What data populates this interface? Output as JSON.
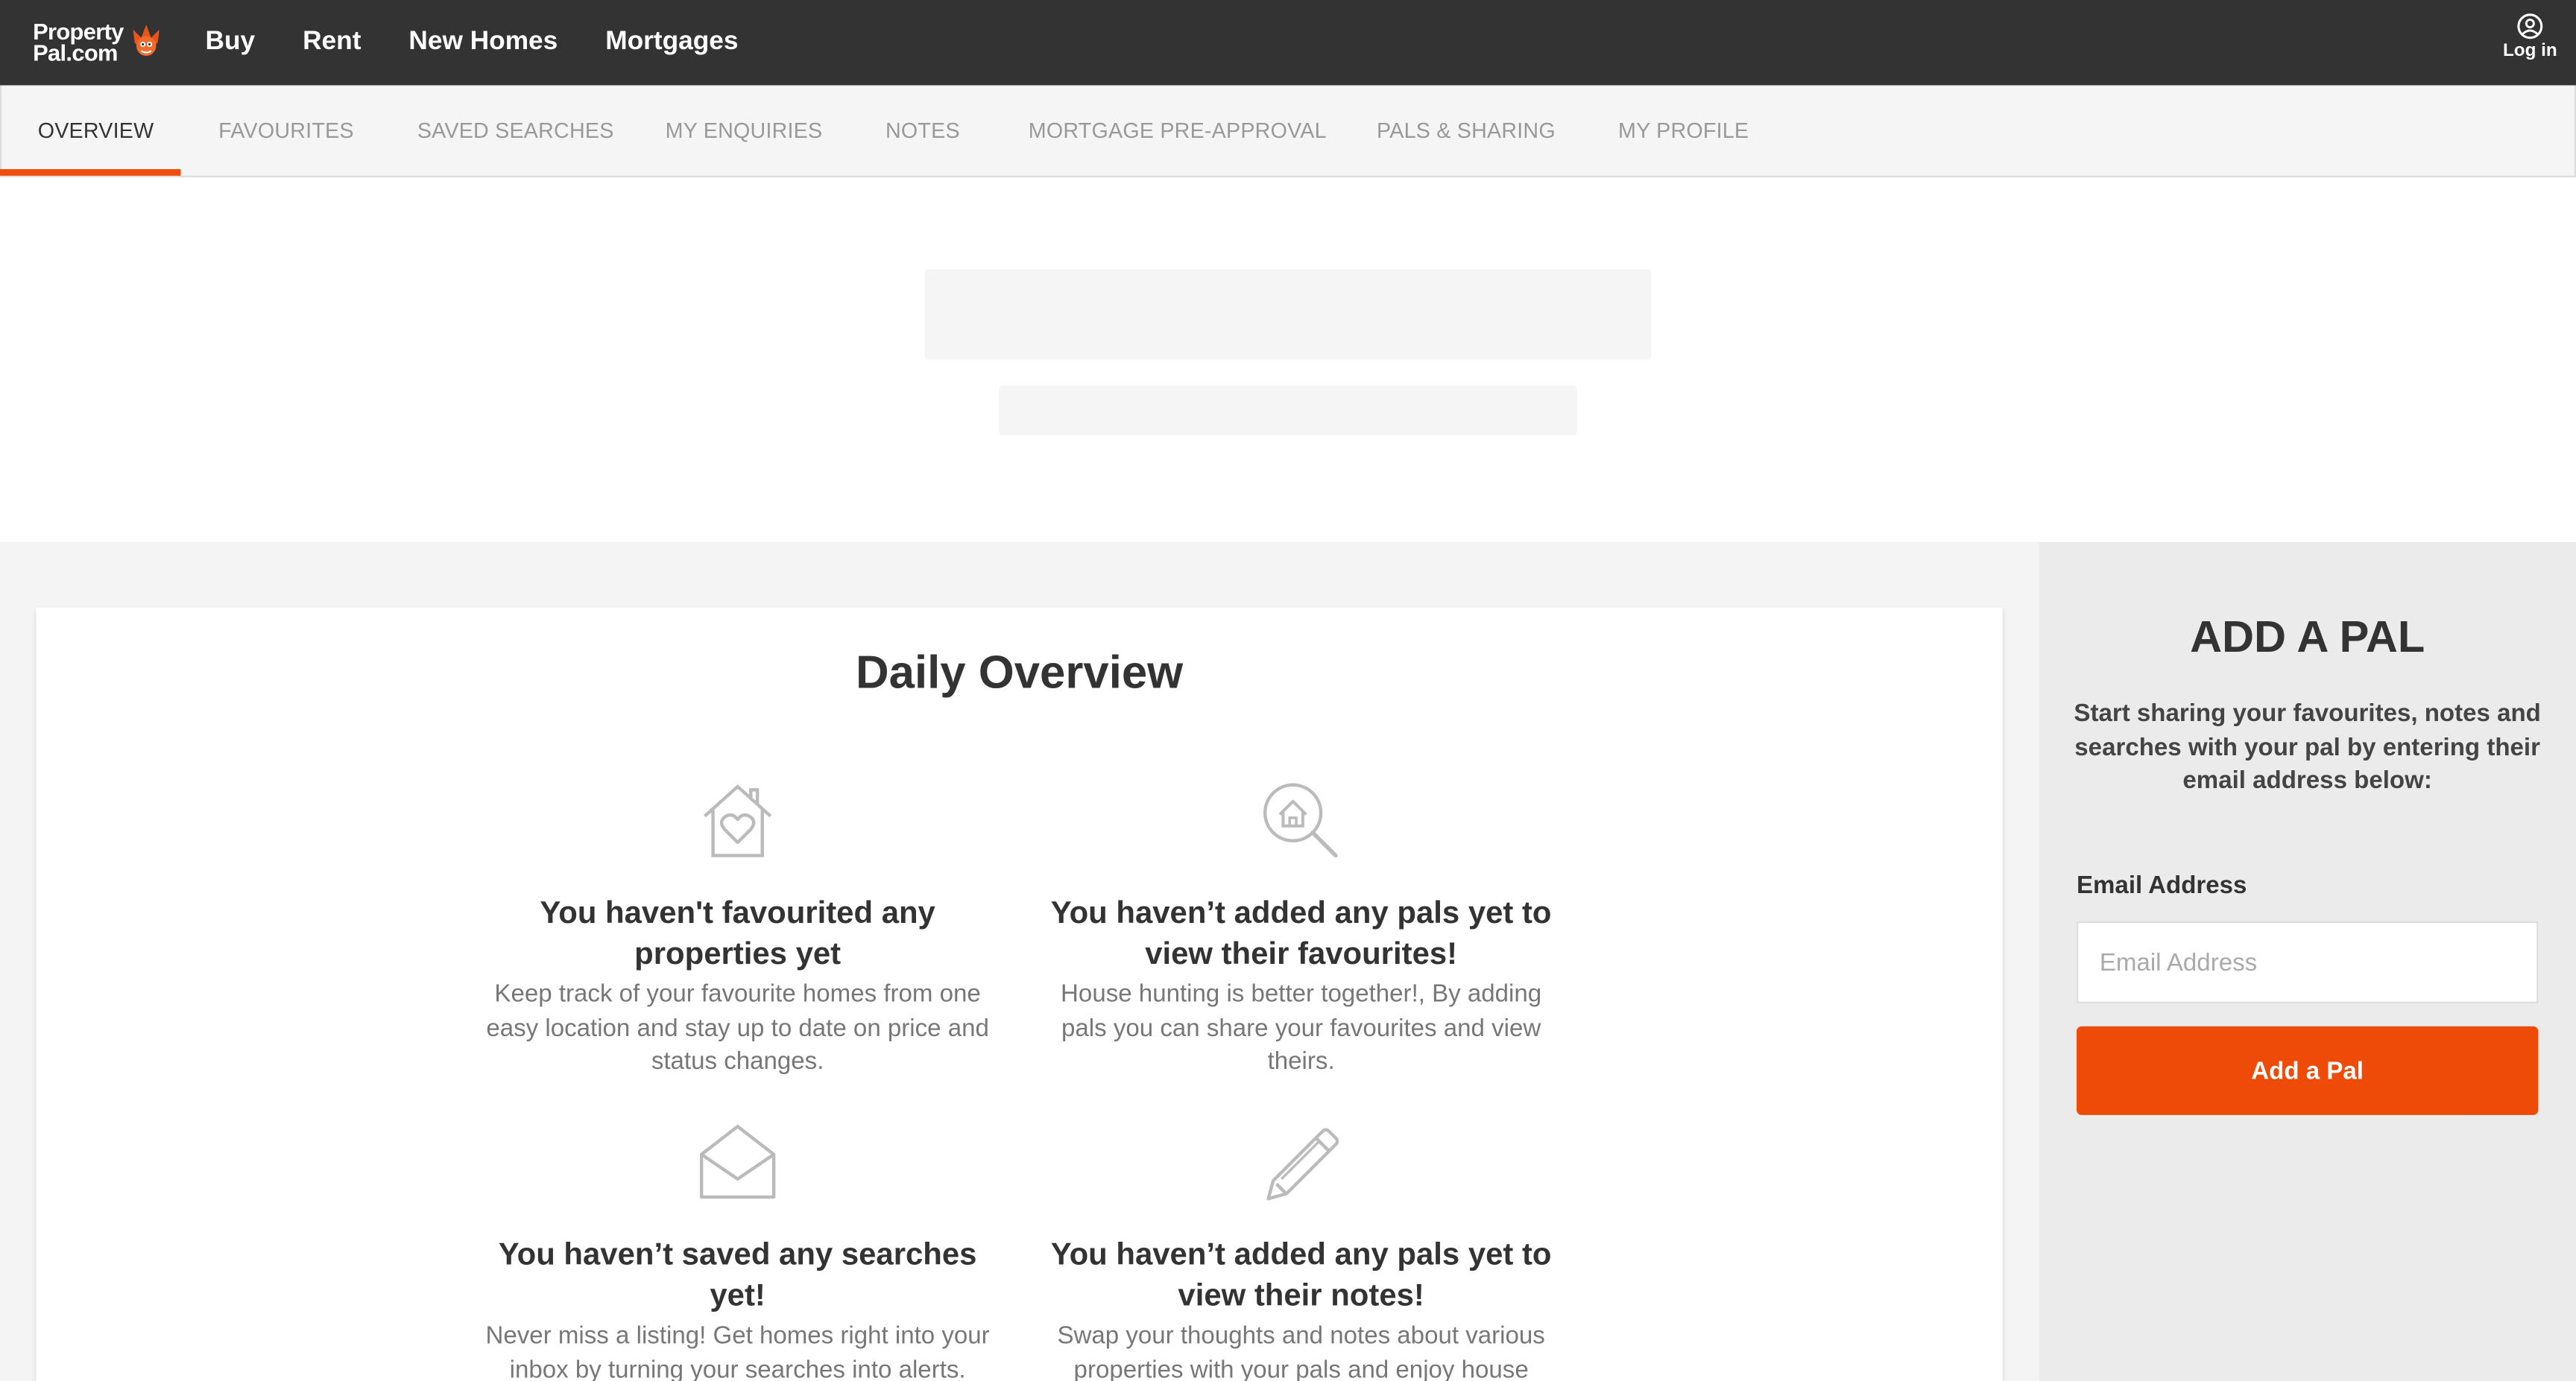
{
  "header": {
    "logo_line1": "Property",
    "logo_line2": "Pal.com",
    "nav": [
      "Buy",
      "Rent",
      "New Homes",
      "Mortgages"
    ],
    "login_label": "Log in"
  },
  "tabs": [
    "OVERVIEW",
    "FAVOURITES",
    "SAVED SEARCHES",
    "MY ENQUIRIES",
    "NOTES",
    "MORTGAGE PRE-APPROVAL",
    "PALS & SHARING",
    "MY PROFILE"
  ],
  "active_tab": "OVERVIEW",
  "overview": {
    "title": "Daily Overview",
    "items": [
      {
        "icon": "house-heart-icon",
        "heading": "You haven't favourited any properties yet",
        "text": "Keep track of your favourite homes from one easy location and stay up to date on price and status changes."
      },
      {
        "icon": "house-search-icon",
        "heading": "You haven’t added any pals yet to view their favourites!",
        "text": "House hunting is better together!, By adding pals you can share your favourites and view theirs."
      },
      {
        "icon": "envelope-icon",
        "heading": "You haven’t saved any searches yet!",
        "text": "Never miss a listing! Get homes right into your inbox by turning your searches into alerts."
      },
      {
        "icon": "pencil-icon",
        "heading": "You haven’t added any pals yet to view their notes!",
        "text": "Swap your thoughts and notes about various properties with your pals and enjoy house"
      }
    ]
  },
  "add_pal": {
    "title": "ADD A PAL",
    "description": "Start sharing your favourites, notes and searches with your pal by entering their email address below:",
    "email_label": "Email Address",
    "email_placeholder": "Email Address",
    "email_value": "",
    "button_label": "Add a Pal"
  },
  "colors": {
    "topbar": "#333333",
    "accent": "#ee4b09",
    "tabbar": "#f5f5f5"
  }
}
